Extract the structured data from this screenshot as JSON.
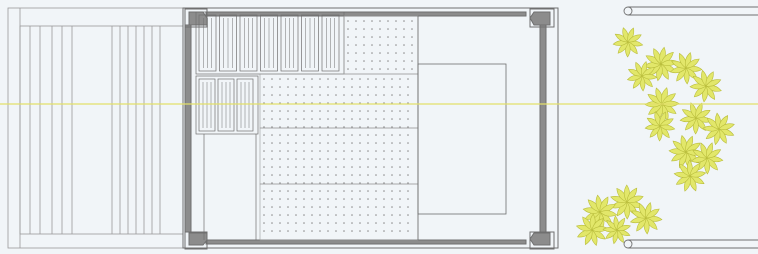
{
  "colors": {
    "background": "#f1f5f8",
    "line": "#6f6f6f",
    "thin_line": "#9a9a9a",
    "wall_fill": "#8c8c8c",
    "dot": "#8a8a8a",
    "section_line": "#e3e06a",
    "plant_fill": "#e2e76a",
    "plant_stroke": "#b9bd3c"
  },
  "drawing": {
    "kind": "architectural floor plan",
    "text_labels": [],
    "elements": [
      "left-deck-slats",
      "building-outline",
      "louvered-panels",
      "perforated-floor",
      "inner-room",
      "section-cut-line",
      "garden-palms"
    ]
  }
}
